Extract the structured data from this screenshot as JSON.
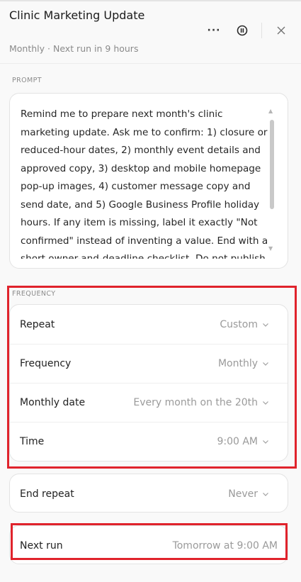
{
  "header": {
    "title": "Clinic Marketing Update",
    "subtitle": "Monthly · Next run in 9 hours",
    "more_icon": "more-horizontal-icon",
    "pause_icon": "pause-circle-icon",
    "close_icon": "close-icon"
  },
  "prompt": {
    "label": "PROMPT",
    "text": "Remind me to prepare next month's clinic marketing update. Ask me to confirm: 1) closure or reduced-hour dates, 2) monthly event details and approved copy, 3) desktop and mobile homepage pop-up images, 4) customer message copy and send date, and 5) Google Business Profile holiday hours. If any item is missing, label it exactly \"Not confirmed\" instead of inventing a value. End with a short owner-and-deadline checklist. Do not publish anything."
  },
  "frequency": {
    "label": "FREQUENCY",
    "rows": [
      {
        "label": "Repeat",
        "value": "Custom"
      },
      {
        "label": "Frequency",
        "value": "Monthly"
      },
      {
        "label": "Monthly date",
        "value": "Every month on the 20th"
      },
      {
        "label": "Time",
        "value": "9:00 AM"
      }
    ]
  },
  "end_repeat": {
    "label": "End repeat",
    "value": "Never"
  },
  "next_run": {
    "label": "Next run",
    "value": "Tomorrow at 9:00 AM"
  },
  "colors": {
    "highlight": "#e0232c",
    "background": "#f9f9f9",
    "card": "#ffffff",
    "muted_text": "#9a9a9a"
  }
}
